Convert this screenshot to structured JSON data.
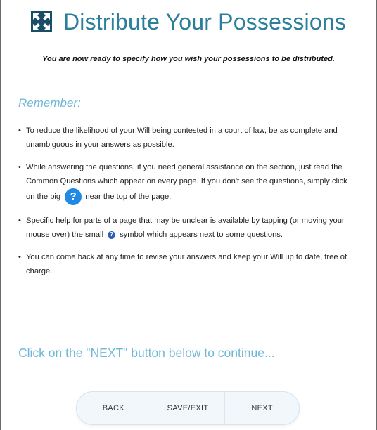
{
  "page": {
    "title": "Distribute Your Possessions",
    "intro": "You are now ready to specify how you wish your possessions to be distributed."
  },
  "remember": {
    "heading": "Remember:",
    "bullet_1": "To reduce the likelihood of your Will being contested in a court of law, be as complete and unambiguous in your answers as possible.",
    "bullet_2_before": "While answering the questions, if you need general assistance on the section, just read the Common Questions which appear on every page. If you don't see the questions, simply click on the big",
    "bullet_2_after": "near the top of the page.",
    "bullet_3_before": "Specific help for parts of a page that may be unclear is available by tapping (or moving your mouse over) the small",
    "bullet_3_after": "symbol which appears next to some questions.",
    "bullet_4": "You can come back at any time to revise your answers and keep your Will up to date, free of charge."
  },
  "help_icon_glyph": "?",
  "cta": "Click on the \"NEXT\" button below to continue...",
  "buttons": {
    "back": "BACK",
    "save_exit": "SAVE/EXIT",
    "next": "NEXT"
  },
  "icons": {
    "logo": "arrows-expand-icon",
    "help": "question-circle-icon"
  },
  "colors": {
    "title": "#2b7f9b",
    "accent_light": "#6fb7d6",
    "help_icon_big": "#1e8ae6",
    "help_icon_small": "#2d61b5",
    "logo": "#1a4d66"
  }
}
